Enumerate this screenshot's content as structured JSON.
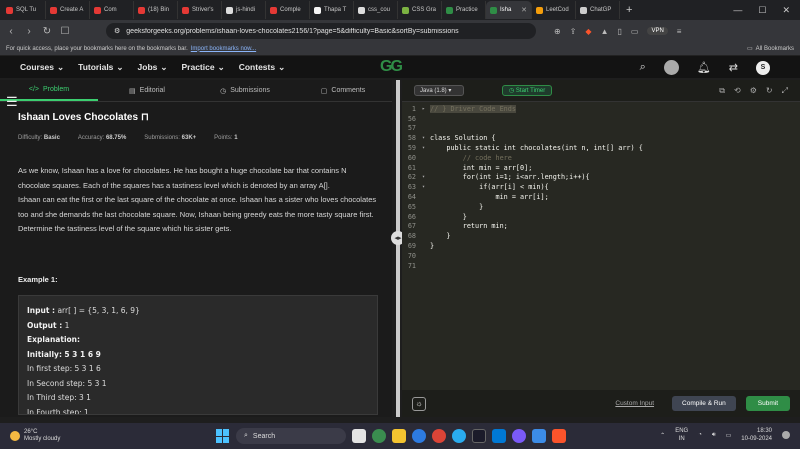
{
  "browser": {
    "tabs": [
      {
        "title": "SQL Tu",
        "color": "#e53935"
      },
      {
        "title": "Create A",
        "color": "#e53935"
      },
      {
        "title": "Com",
        "color": "#e53935"
      },
      {
        "title": "(18) Bin",
        "color": "#e53935"
      },
      {
        "title": "Striver's",
        "color": "#e53935"
      },
      {
        "title": "js-hindi",
        "color": "#ddd"
      },
      {
        "title": "Comple",
        "color": "#e53935"
      },
      {
        "title": "Thapa T",
        "color": "#f5f5f5"
      },
      {
        "title": "css_cou",
        "color": "#ddd"
      },
      {
        "title": "CSS Gra",
        "color": "#7cb342"
      },
      {
        "title": "Practice",
        "color": "#2f8d46"
      },
      {
        "title": "Isha",
        "color": "#2f8d46"
      },
      {
        "title": "LeetCod",
        "color": "#f59e0b"
      },
      {
        "title": "ChatGP",
        "color": "#ccc"
      }
    ],
    "active_tab": 11,
    "new_tab": "+",
    "url": "geeksforgeeks.org/problems/ishaan-loves-chocolates2156/1?page=5&difficulty=Basic&sortBy=submissions",
    "vpn_label": "VPN",
    "bookmarks_hint": "For quick access, place your bookmarks here on the bookmarks bar.",
    "bookmarks_import": "Import bookmarks now...",
    "all_bookmarks": "All Bookmarks"
  },
  "site": {
    "logo": "GG",
    "menus": [
      "Courses",
      "Tutorials",
      "Jobs",
      "Practice",
      "Contests"
    ],
    "avatar": "S"
  },
  "problem": {
    "tabs": [
      {
        "label": "Problem",
        "icon": "</>"
      },
      {
        "label": "Editorial",
        "icon": "▤"
      },
      {
        "label": "Submissions",
        "icon": "◷"
      },
      {
        "label": "Comments",
        "icon": "▢"
      }
    ],
    "title": "Ishaan Loves Chocolates",
    "difficulty_label": "Difficulty:",
    "difficulty": "Basic",
    "accuracy_label": "Accuracy:",
    "accuracy": "68.75%",
    "submissions_label": "Submissions:",
    "submissions": "63K+",
    "points_label": "Points:",
    "points": "1",
    "description": [
      "As we know, Ishaan has a love for chocolates. He has bought a huge chocolate bar that contains N chocolate squares. Each of the squares has a tastiness level which is denoted by an array A[].",
      "Ishaan can eat the first or the last square of the chocolate at once. Ishaan has a sister who loves chocolates too and she demands the last chocolate square. Now, Ishaan being greedy eats the more tasty square first.",
      "Determine the tastiness level of the square which his sister gets."
    ],
    "example_label": "Example 1:",
    "example": {
      "input_label": "Input :",
      "input": "arr[ ] = {5, 3, 1, 6, 9}",
      "output_label": "Output :",
      "output": "1",
      "explanation_label": "Explanation:",
      "initially_label": "Initially:",
      "initially": "5 3 1 6 9",
      "steps": [
        "In  first  step:  5  3  1  6",
        "In  Second  step:  5  3  1",
        "In  Third  step:  3  1",
        "In  Fourth  step:  1"
      ]
    }
  },
  "editor": {
    "language": "Java (1.8)",
    "timer_label": "Start Timer",
    "custom_input": "Custom Input",
    "compile_run": "Compile & Run",
    "submit": "Submit",
    "lines": [
      {
        "n": "1",
        "fold": "▸",
        "text": "// } Driver Code Ends",
        "cls": "cm"
      },
      {
        "n": "56",
        "fold": "",
        "text": "",
        "cls": "txt"
      },
      {
        "n": "57",
        "fold": "",
        "text": "",
        "cls": "txt"
      },
      {
        "n": "58",
        "fold": "▾",
        "text": "class Solution {",
        "cls": "txt"
      },
      {
        "n": "59",
        "fold": "▾",
        "text": "    public static int chocolates(int n, int[] arr) {",
        "cls": "txt"
      },
      {
        "n": "60",
        "fold": "",
        "text": "        // code here",
        "cls": "cm"
      },
      {
        "n": "61",
        "fold": "",
        "text": "        int min = arr[0];",
        "cls": "txt"
      },
      {
        "n": "62",
        "fold": "▾",
        "text": "        for(int i=1; i<arr.length;i++){",
        "cls": "txt"
      },
      {
        "n": "63",
        "fold": "▾",
        "text": "            if(arr[i] < min){",
        "cls": "txt"
      },
      {
        "n": "64",
        "fold": "",
        "text": "                min = arr[i];",
        "cls": "txt"
      },
      {
        "n": "65",
        "fold": "",
        "text": "            }",
        "cls": "txt"
      },
      {
        "n": "66",
        "fold": "",
        "text": "        }",
        "cls": "txt"
      },
      {
        "n": "67",
        "fold": "",
        "text": "        return min;",
        "cls": "txt"
      },
      {
        "n": "68",
        "fold": "",
        "text": "    }",
        "cls": "txt"
      },
      {
        "n": "69",
        "fold": "",
        "text": "}",
        "cls": "txt"
      },
      {
        "n": "70",
        "fold": "",
        "text": "",
        "cls": "txt"
      },
      {
        "n": "71",
        "fold": "",
        "text": "",
        "cls": "txt"
      }
    ]
  },
  "taskbar": {
    "temperature": "26°C",
    "weather": "Mostly cloudy",
    "search": "Search",
    "lang1": "ENG",
    "lang2": "IN",
    "time": "18:30",
    "date": "10-09-2024"
  },
  "colors": {
    "accent": "#2f8d46",
    "active_tab_text": "#3ccf70"
  }
}
